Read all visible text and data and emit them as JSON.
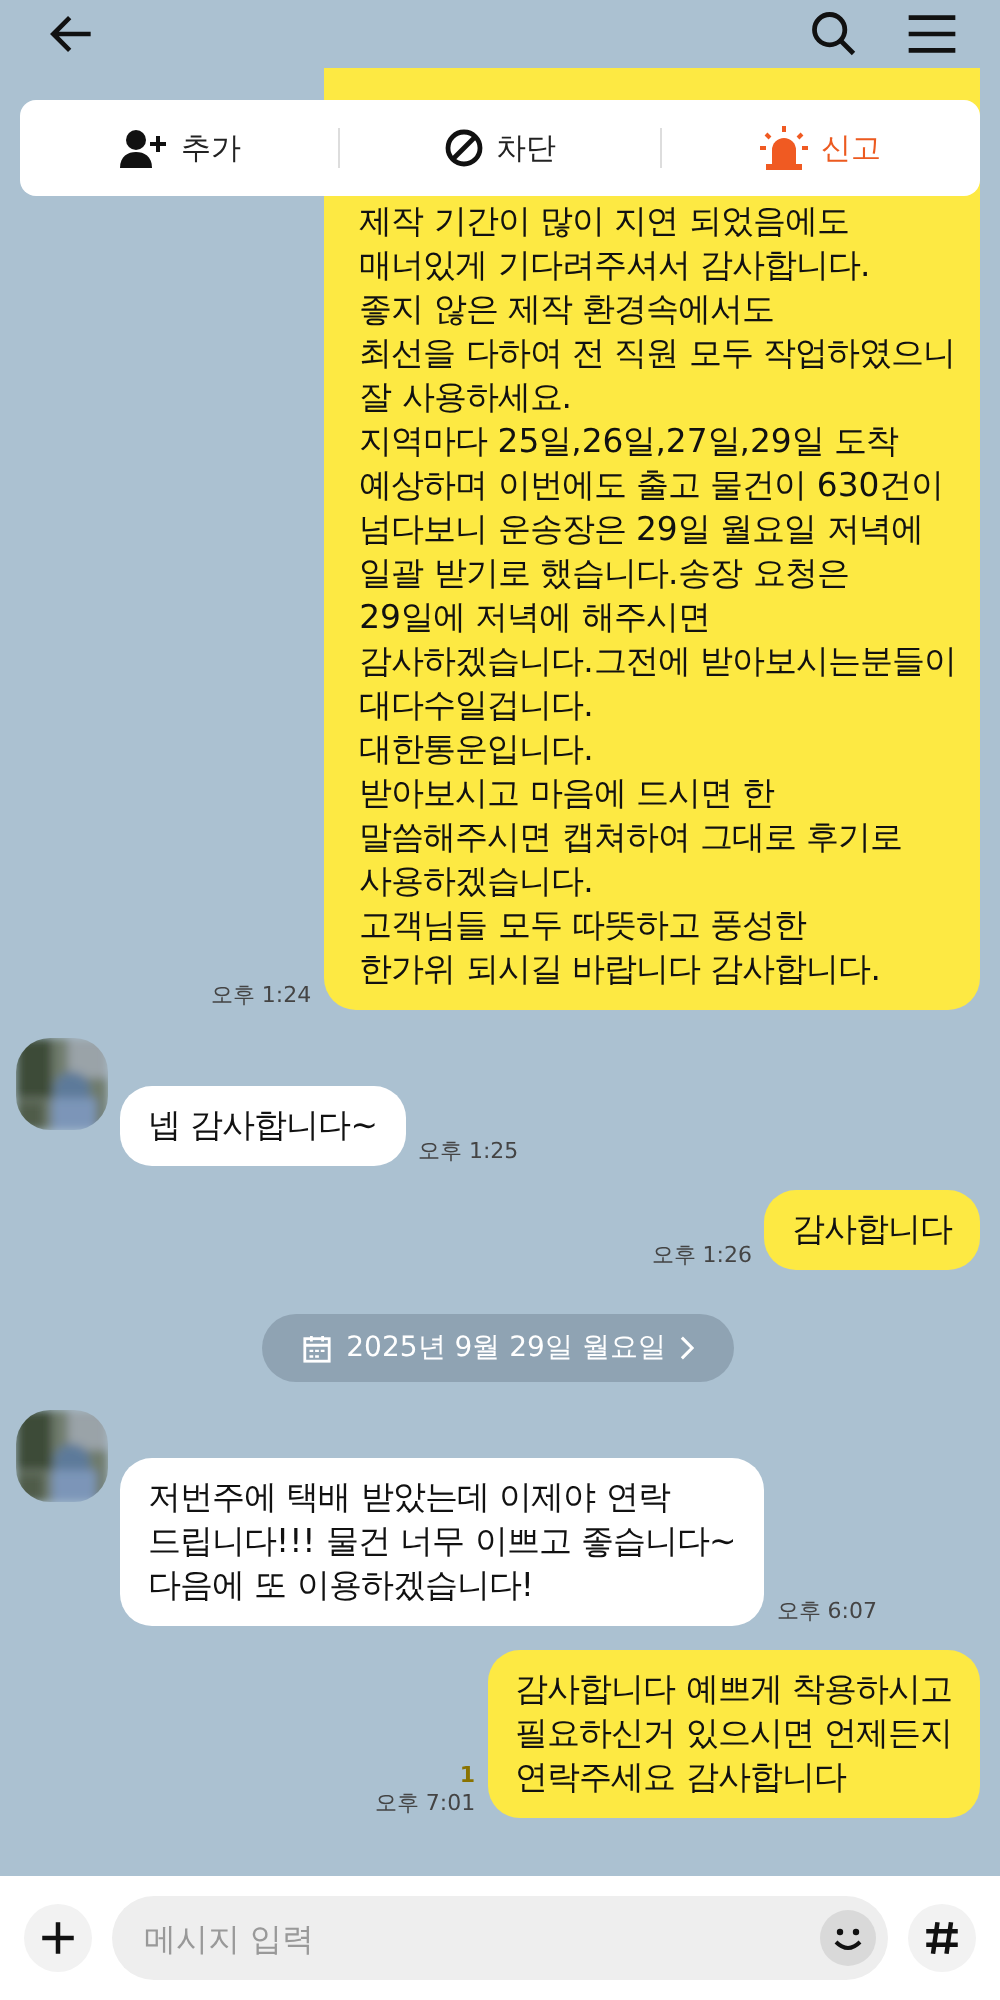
{
  "actions": [
    {
      "kind": "add",
      "label": "추가"
    },
    {
      "kind": "block",
      "label": "차단"
    },
    {
      "kind": "report",
      "label": "신고"
    }
  ],
  "messages": [
    {
      "kind": "sent",
      "text": "제작 기간이 많이 지연 되었음에도\n매너있게 기다려주셔서 감사합니다.\n좋지 않은 제작 환경속에서도\n최선을 다하여 전 직원 모두 작업하였으니\n잘 사용하세요.\n지역마다 25일,26일,27일,29일 도착\n예상하며 이번에도 출고 물건이 630건이\n넘다보니 운송장은 29일 월요일 저녁에\n일괄 받기로 했습니다.송장 요청은\n29일에 저녁에 해주시면\n감사하겠습니다.그전에 받아보시는분들이\n대다수일겁니다.\n대한통운입니다.\n받아보시고 마음에 드시면 한\n말씀해주시면 캡쳐하여 그대로 후기로\n사용하겠습니다.\n고객님들 모두 따뜻하고 풍성한\n한가위 되시길 바랍니다 감사합니다.",
      "time": "오후 1:24",
      "clipped": true
    },
    {
      "kind": "received",
      "text": "넵 감사합니다~",
      "time": "오후 1:25"
    },
    {
      "kind": "sent",
      "text": "감사합니다",
      "time": "오후 1:26"
    },
    {
      "kind": "date",
      "text": "2025년 9월 29일 월요일"
    },
    {
      "kind": "received",
      "text": "저번주에 택배 받았는데 이제야 연락\n드립니다!!! 물건 너무 이쁘고 좋습니다~\n다음에 또 이용하겠습니다!",
      "time": "오후 6:07"
    },
    {
      "kind": "sent",
      "text": "감사합니다 예쁘게 착용하시고\n필요하신거 있으시면 언제든지\n연락주세요 감사합니다",
      "time": "오후 7:01",
      "unread": "1"
    }
  ],
  "input": {
    "placeholder": "메시지 입력"
  }
}
